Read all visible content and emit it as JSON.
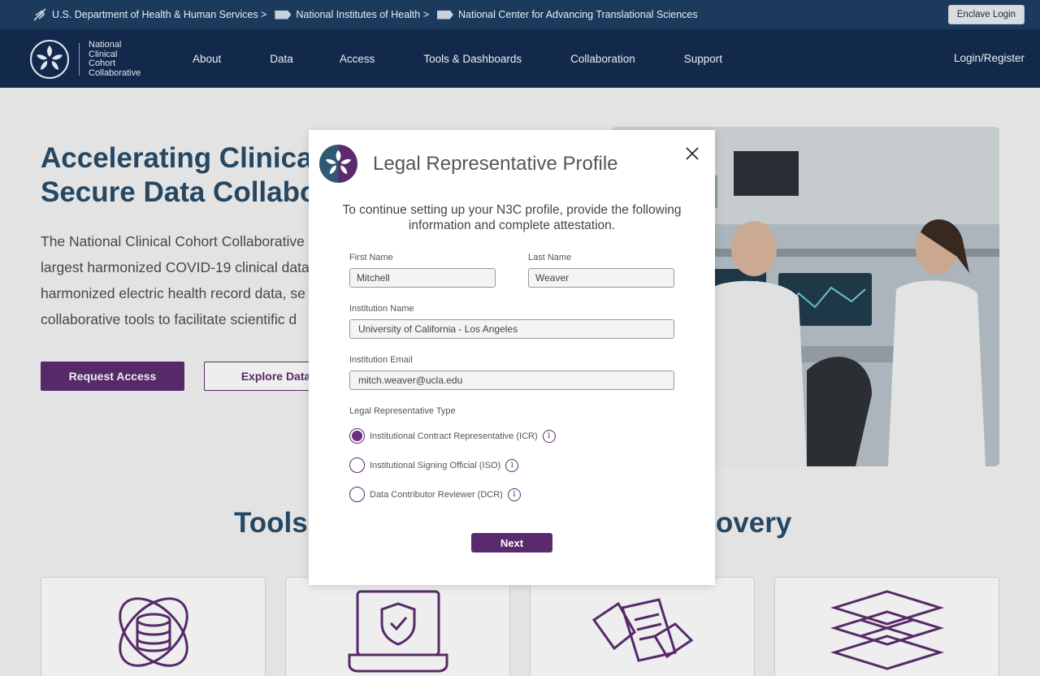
{
  "govbar": {
    "crumbs": [
      "U.S. Department of Health & Human Services >",
      "National Institutes of Health >",
      "National Center for Advancing Translational Sciences"
    ],
    "enclave_login": "Enclave Login"
  },
  "header": {
    "logo_lines": [
      "National",
      "Clinical",
      "Cohort",
      "Collaborative"
    ],
    "nav": [
      "About",
      "Data",
      "Access",
      "Tools & Dashboards",
      "Collaboration",
      "Support"
    ],
    "login": "Login/Register"
  },
  "hero": {
    "title_line1": "Accelerating Clinical",
    "title_line2": "Secure Data Collabor",
    "text_lines": [
      "The National Clinical Cohort Collaborative",
      "largest harmonized COVID-19 clinical data",
      "harmonized electric health record data, se",
      "collaborative tools to facilitate scientific d"
    ],
    "request_access": "Request Access",
    "explore_data": "Explore Data"
  },
  "section": {
    "title_left": "Tools",
    "title_right": "scovery"
  },
  "modal": {
    "title": "Legal Representative Profile",
    "intro": "To continue setting up your N3C profile, provide the following information and complete attestation.",
    "first_name_label": "First Name",
    "first_name_value": "Mitchell",
    "last_name_label": "Last Name",
    "last_name_value": "Weaver",
    "institution_label": "Institution Name",
    "institution_value": "University of California - Los Angeles",
    "email_label": "Institution Email",
    "email_value": "mitch.weaver@ucla.edu",
    "type_label": "Legal Representative Type",
    "types": [
      {
        "label": "Institutional Contract Representative (ICR)",
        "selected": true
      },
      {
        "label": "Institutional Signing Official (ISO)",
        "selected": false
      },
      {
        "label": "Data Contributor Reviewer (DCR)",
        "selected": false
      }
    ],
    "next": "Next"
  },
  "colors": {
    "accent": "#5b2a6e",
    "navy": "#13294b",
    "govbar": "#1c3a5c",
    "heading": "#274a66"
  }
}
